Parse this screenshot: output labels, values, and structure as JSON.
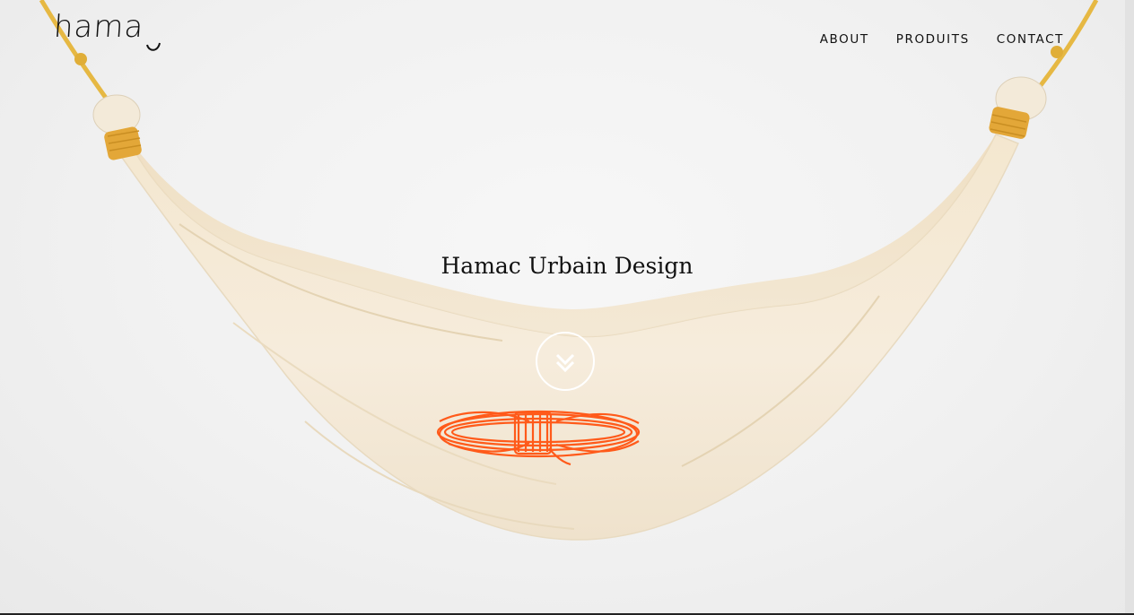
{
  "brand": {
    "logo_text": "hama"
  },
  "nav": {
    "items": [
      {
        "label": "ABOUT"
      },
      {
        "label": "PRODUITS"
      },
      {
        "label": "CONTACT"
      }
    ]
  },
  "hero": {
    "title": "Hamac Urbain Design",
    "scroll_icon": "chevron-double-down-icon"
  },
  "colors": {
    "rope": "#e8b84a",
    "fabric": "#f6ead6",
    "print": "#ff5a1a",
    "text": "#111111"
  }
}
